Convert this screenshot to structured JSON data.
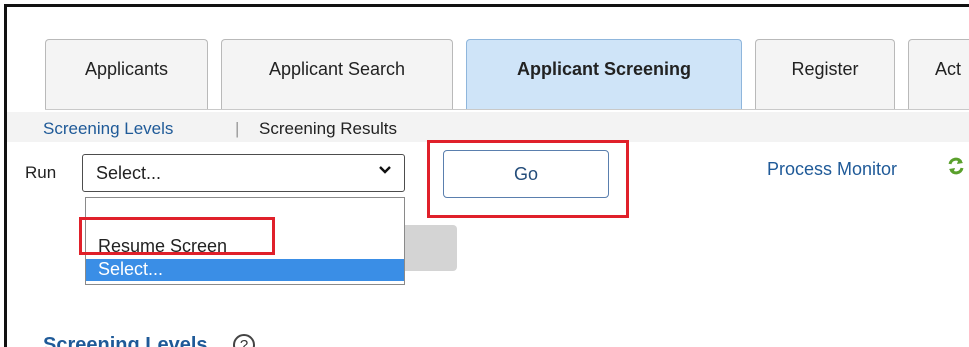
{
  "tabs": [
    {
      "label": "Applicants",
      "active": false
    },
    {
      "label": "Applicant Search",
      "active": false
    },
    {
      "label": "Applicant Screening",
      "active": true
    },
    {
      "label": "Register",
      "active": false
    },
    {
      "label": "Act",
      "active": false
    }
  ],
  "subnav": {
    "screening_levels": "Screening Levels",
    "separator": "|",
    "screening_results": "Screening Results"
  },
  "run": {
    "label": "Run",
    "selected_value": "Select...",
    "options": [
      "",
      "Resume Screen",
      "Select..."
    ]
  },
  "go_label": "Go",
  "process_monitor_label": "Process Monitor",
  "section": {
    "title": "Screening Levels",
    "help_glyph": "?"
  },
  "colors": {
    "link": "#1f5a98",
    "active_tab": "#cfe4f8",
    "highlight_box": "#e0202a",
    "selected_option": "#3a8ee6",
    "refresh_icon": "#5aa02c"
  }
}
